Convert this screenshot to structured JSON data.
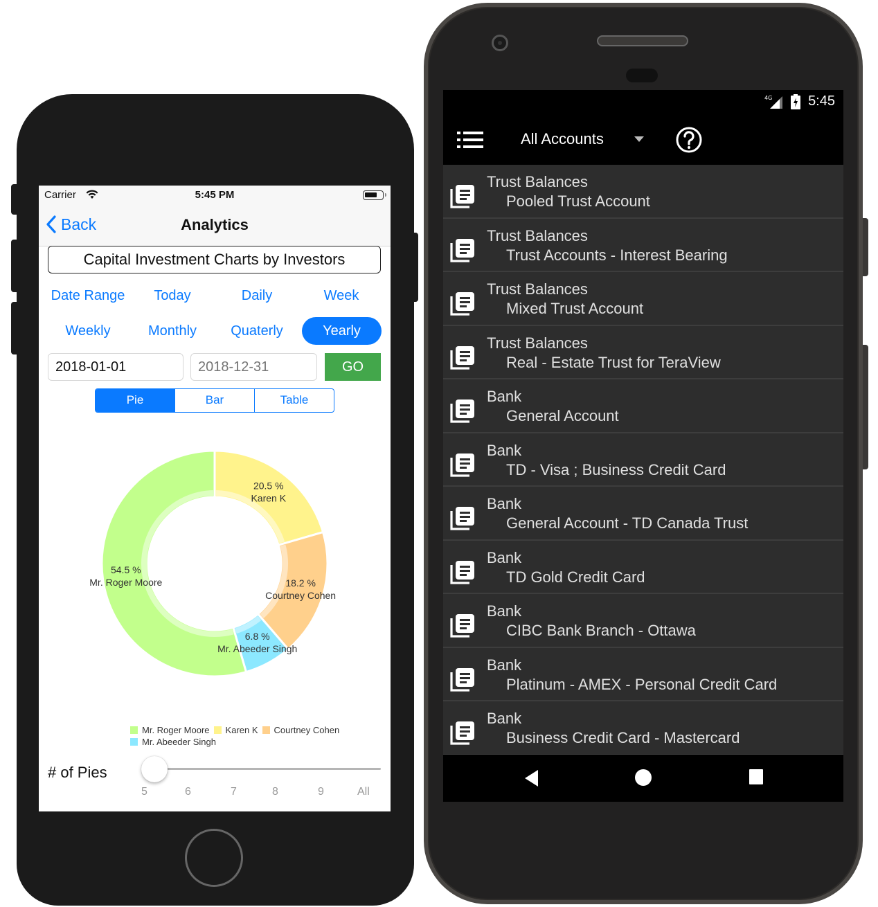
{
  "ios": {
    "status": {
      "carrier": "Carrier",
      "time": "5:45 PM"
    },
    "nav": {
      "back_label": "Back",
      "title": "Analytics"
    },
    "chart_title": "Capital Investment Charts by Investors",
    "range_buttons": [
      {
        "label": "Date Range",
        "active": false
      },
      {
        "label": "Today",
        "active": false
      },
      {
        "label": "Daily",
        "active": false
      },
      {
        "label": "Week",
        "active": false
      },
      {
        "label": "Weekly",
        "active": false
      },
      {
        "label": "Monthly",
        "active": false
      },
      {
        "label": "Quaterly",
        "active": false
      },
      {
        "label": "Yearly",
        "active": true
      }
    ],
    "date_from": {
      "value": "2018-01-01"
    },
    "date_to": {
      "placeholder": "2018-12-31"
    },
    "go_label": "GO",
    "view_tabs": [
      {
        "label": "Pie",
        "active": true
      },
      {
        "label": "Bar",
        "active": false
      },
      {
        "label": "Table",
        "active": false
      }
    ],
    "pies_label": "# of Pies",
    "slider": {
      "ticks": [
        "5",
        "6",
        "7",
        "8",
        "9",
        "All"
      ],
      "selected": "5"
    },
    "colors": {
      "accent": "#0a7aff",
      "go": "#43a74b"
    }
  },
  "chart_data": {
    "type": "pie",
    "variant": "donut",
    "title": "Capital Investment Charts by Investors",
    "legend_position": "bottom-right",
    "slices": [
      {
        "name": "Karen  K",
        "value": 20.5,
        "label": "20.5 %",
        "color": "#fff38c"
      },
      {
        "name": "Courtney  Cohen",
        "value": 18.2,
        "label": "18.2 %",
        "color": "#ffd08c"
      },
      {
        "name": "Mr. Abeeder  Singh",
        "value": 6.8,
        "label": "6.8 %",
        "color": "#8ce8ff"
      },
      {
        "name": "Mr. Roger  Moore",
        "value": 54.5,
        "label": "54.5 %",
        "color": "#c2ff8c"
      }
    ],
    "legend": [
      "Mr. Roger  Moore",
      "Karen  K",
      "Courtney  Cohen",
      "Mr. Abeeder  Singh"
    ]
  },
  "android": {
    "status": {
      "network": "4G",
      "time": "5:45"
    },
    "toolbar": {
      "account_selector": "All Accounts"
    },
    "accounts": [
      {
        "category": "Trust Balances",
        "name": "Pooled Trust Account"
      },
      {
        "category": "Trust Balances",
        "name": "Trust Accounts - Interest Bearing"
      },
      {
        "category": "Trust Balances",
        "name": "Mixed Trust Account"
      },
      {
        "category": "Trust Balances",
        "name": "Real - Estate Trust for TeraView"
      },
      {
        "category": "Bank",
        "name": "General Account"
      },
      {
        "category": "Bank",
        "name": "TD - Visa ; Business Credit Card"
      },
      {
        "category": "Bank",
        "name": "General Account - TD Canada Trust"
      },
      {
        "category": "Bank",
        "name": "TD Gold Credit Card"
      },
      {
        "category": "Bank",
        "name": "CIBC Bank Branch - Ottawa"
      },
      {
        "category": "Bank",
        "name": "Platinum - AMEX - Personal Credit Card"
      },
      {
        "category": "Bank",
        "name": "Business Credit Card - Mastercard"
      }
    ]
  }
}
